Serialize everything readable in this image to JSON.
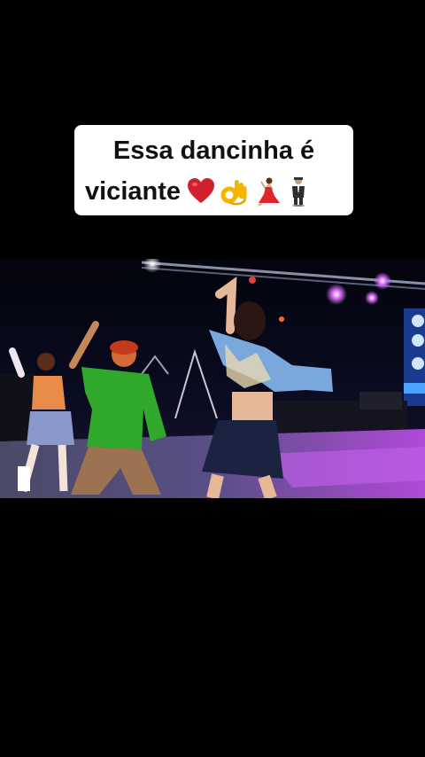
{
  "caption": {
    "line1": "Essa dancinha é",
    "line2": "viciante",
    "emojis": [
      "red-heart-icon",
      "ok-hand-icon",
      "dancer-woman-icon",
      "man-in-suit-levitating-icon"
    ]
  },
  "video": {
    "scene": "dance-performance-stage"
  },
  "colors": {
    "background": "#000000",
    "caption_bg": "#ffffff",
    "caption_text": "#111111",
    "stage_purple": "#b04bd8",
    "shirt_green": "#2fa82c"
  }
}
